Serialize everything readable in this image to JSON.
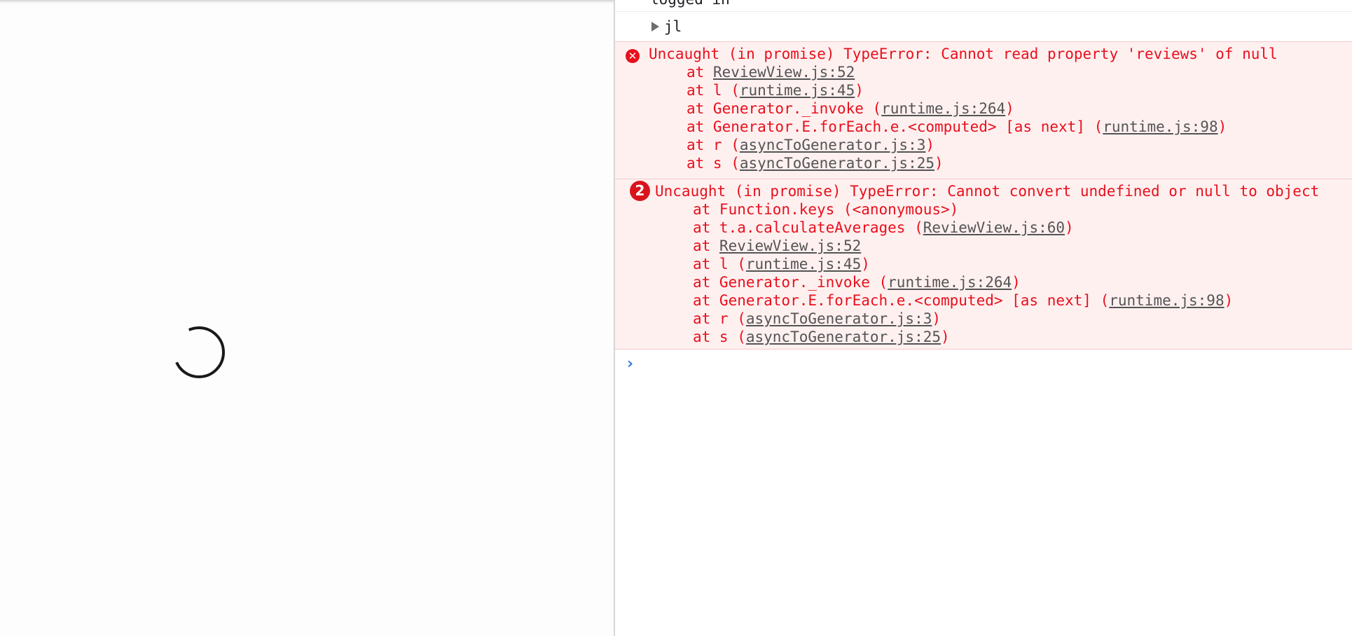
{
  "console": {
    "previous_log": "logged in",
    "object_label": "jl",
    "prompt_symbol": "›",
    "errors": [
      {
        "icon": "error-circle-icon",
        "message": "Uncaught (in promise) TypeError: Cannot read property 'reviews' of null",
        "stack": [
          {
            "prefix": "at ",
            "link": "ReviewView.js:52",
            "suffix": ""
          },
          {
            "prefix": "at l (",
            "link": "runtime.js:45",
            "suffix": ")"
          },
          {
            "prefix": "at Generator._invoke (",
            "link": "runtime.js:264",
            "suffix": ")"
          },
          {
            "prefix": "at Generator.E.forEach.e.<computed> [as next] (",
            "link": "runtime.js:98",
            "suffix": ")"
          },
          {
            "prefix": "at r (",
            "link": "asyncToGenerator.js:3",
            "suffix": ")"
          },
          {
            "prefix": "at s (",
            "link": "asyncToGenerator.js:25",
            "suffix": ")"
          }
        ]
      },
      {
        "count": "2",
        "message": "Uncaught (in promise) TypeError: Cannot convert undefined or null to object",
        "stack": [
          {
            "prefix": "at Function.keys (<anonymous>)",
            "link": "",
            "suffix": ""
          },
          {
            "prefix": "at t.a.calculateAverages (",
            "link": "ReviewView.js:60",
            "suffix": ")"
          },
          {
            "prefix": "at ",
            "link": "ReviewView.js:52",
            "suffix": ""
          },
          {
            "prefix": "at l (",
            "link": "runtime.js:45",
            "suffix": ")"
          },
          {
            "prefix": "at Generator._invoke (",
            "link": "runtime.js:264",
            "suffix": ")"
          },
          {
            "prefix": "at Generator.E.forEach.e.<computed> [as next] (",
            "link": "runtime.js:98",
            "suffix": ")"
          },
          {
            "prefix": "at r (",
            "link": "asyncToGenerator.js:3",
            "suffix": ")"
          },
          {
            "prefix": "at s (",
            "link": "asyncToGenerator.js:25",
            "suffix": ")"
          }
        ]
      }
    ]
  }
}
